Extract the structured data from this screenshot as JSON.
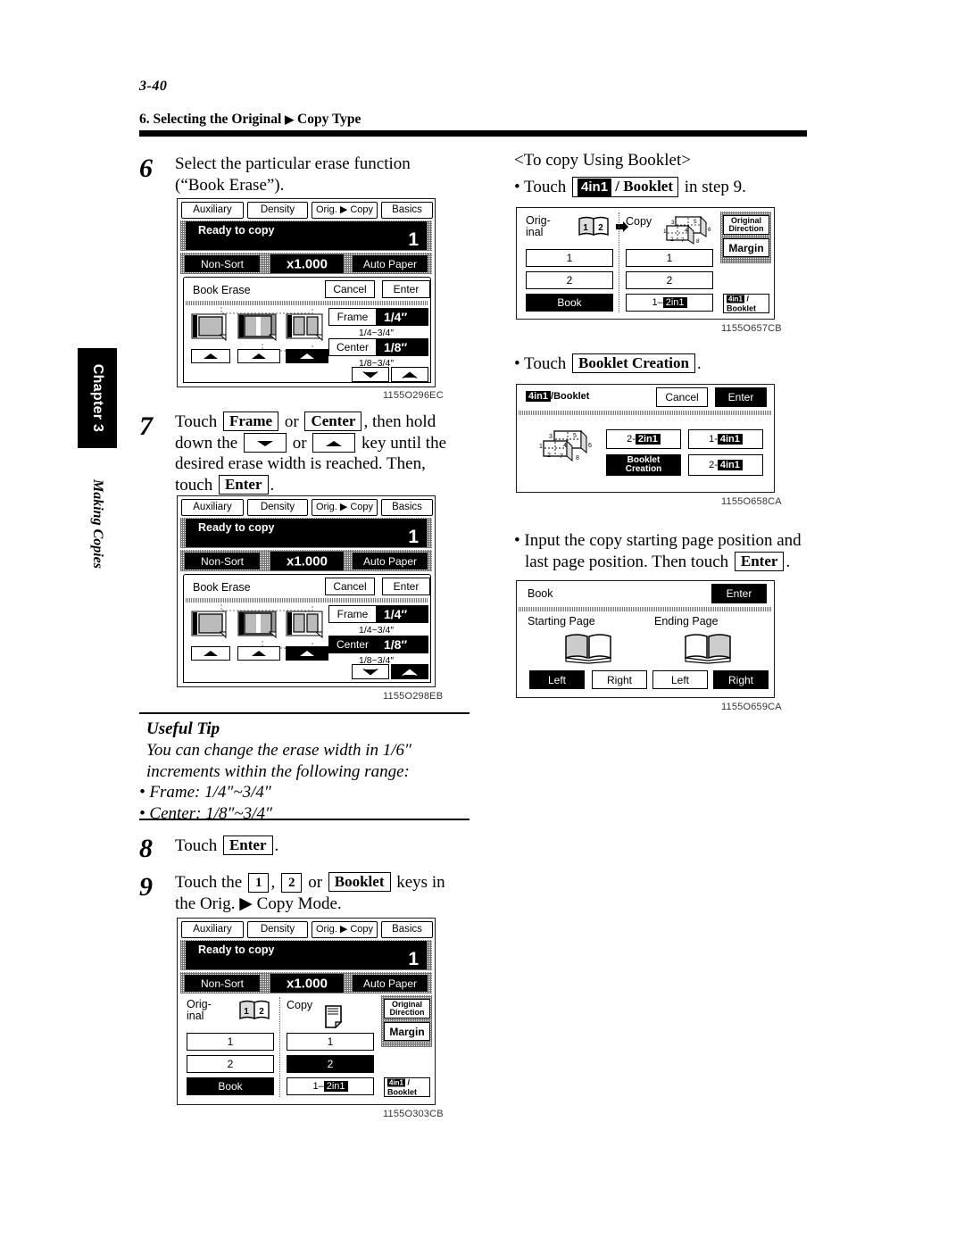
{
  "page": {
    "folio": "3-40",
    "section_title": "6. Selecting the Original",
    "section_title_tail": "Copy Type",
    "chapter_tab": "Chapter 3",
    "chapter_subtitle": "Making Copies"
  },
  "steps": {
    "s6": {
      "num": "6",
      "line1": "Select the particular erase function",
      "line2": "(“Book Erase”)."
    },
    "s7": {
      "num": "7",
      "t1": "Touch",
      "k_frame": "Frame",
      "t2": "or",
      "k_center": "Center",
      "t3": ", then hold",
      "t4": "down the",
      "t5": "or",
      "t6": "key until the",
      "t7": "desired erase width is reached. Then,",
      "t8": "touch",
      "k_enter": "Enter",
      "t9": "."
    },
    "s8": {
      "num": "8",
      "t1": "Touch",
      "k_enter": "Enter",
      "t2": "."
    },
    "s9": {
      "num": "9",
      "t1": "Touch the",
      "k_1": "1",
      "t2": ",",
      "k_2": "2",
      "t3": "or",
      "k_booklet": "Booklet",
      "t4": "keys in",
      "t5": "the Orig.",
      "t6": "Copy Mode."
    }
  },
  "useful_tip": {
    "title": "Useful Tip",
    "line1": "You can change the erase width in 1/6″",
    "line2": "increments within the following range:",
    "bullet1": "• Frame: 1/4″~3/4″",
    "bullet2": "• Center: 1/8″~3/4″"
  },
  "right_column": {
    "heading": "<To copy Using Booklet>",
    "b1": {
      "t1": "• Touch",
      "k_4in1": "4in1",
      "k_booklet": "/ Booklet",
      "t2": "in step 9."
    },
    "b2": {
      "t1": "• Touch",
      "k_bookletcreation": "Booklet Creation",
      "t2": "."
    },
    "b3": {
      "line1": "• Input the copy starting page position and",
      "line2a": "last page position. Then touch",
      "k_enter": "Enter",
      "line2b": "."
    }
  },
  "figure_codes": {
    "f1": "1155O296EC",
    "f2": "1155O298EB",
    "f3": "1155O303CB",
    "f4": "1155O657CB",
    "f5": "1155O658CA",
    "f6": "1155O659CA"
  },
  "lcd_common": {
    "tabs": [
      "Auxiliary",
      "Density",
      "Orig. ▶ Copy",
      "Basics"
    ],
    "status_text": "Ready to copy",
    "copy_count": "1",
    "mode_buttons": [
      "Non-Sort",
      "x1.000",
      "Auto Paper"
    ]
  },
  "book_erase_panel_a": {
    "title": "Book Erase",
    "cancel": "Cancel",
    "enter": "Enter",
    "frame_label": "Frame",
    "frame_value": "1/4″",
    "frame_range": "1/4~3/4″",
    "center_label": "Center",
    "center_value": "1/8″",
    "center_range": "1/8~3/4″",
    "selected_mode_index": 2,
    "frame_selected": false,
    "center_selected": false,
    "up_key_selected": false,
    "down_key_selected": false
  },
  "book_erase_panel_b": {
    "title": "Book Erase",
    "cancel": "Cancel",
    "enter": "Enter",
    "frame_label": "Frame",
    "frame_value": "1/4″",
    "frame_range": "1/4~3/4″",
    "center_label": "Center",
    "center_value": "1/8″",
    "center_range": "1/8~3/4″",
    "selected_mode_index": 2,
    "frame_selected": false,
    "center_selected": true,
    "up_key_selected": true,
    "down_key_selected": false
  },
  "orig_copy_panel_2in1": {
    "original_label_1": "Orig-",
    "original_label_2": "inal",
    "copy_label": "Copy",
    "original_keys": [
      "1",
      "2",
      "Book"
    ],
    "copy_keys": [
      "1",
      "2",
      "1– 2in1"
    ],
    "original_selected": "Book",
    "copy_selected": "2",
    "side_buttons": [
      "Original Direction",
      "Margin",
      "4in1 / Booklet"
    ],
    "original_thumb_digits": [
      "1",
      "2"
    ]
  },
  "orig_copy_panel_4in1": {
    "original_label_1": "Orig-",
    "original_label_2": "inal",
    "copy_label": "Copy",
    "original_keys": [
      "1",
      "2",
      "Book"
    ],
    "copy_keys": [
      "1",
      "2",
      "1– 2in1"
    ],
    "original_selected": "Book",
    "copy_selected": "none",
    "side_buttons": [
      "Original Direction",
      "Margin",
      "4in1 / Booklet"
    ],
    "thumb_digits": [
      "1",
      "2",
      "3",
      "4",
      "5",
      "6",
      "7",
      "8"
    ]
  },
  "booklet_panel": {
    "title_mark": "4in1",
    "title_rest": "/Booklet",
    "cancel": "Cancel",
    "enter": "Enter",
    "keys": [
      {
        "pre": "2-",
        "mark": "2in1",
        "selected": false
      },
      {
        "pre": "1-",
        "mark": "4in1",
        "selected": false
      },
      {
        "pre": "",
        "mark": "Booklet Creation",
        "selected": true
      },
      {
        "pre": "2-",
        "mark": "4in1",
        "selected": false
      }
    ]
  },
  "book_page_panel": {
    "title": "Book",
    "enter": "Enter",
    "starting_label": "Starting Page",
    "ending_label": "Ending Page",
    "starting_keys": [
      {
        "label": "Left",
        "selected": true
      },
      {
        "label": "Right",
        "selected": false
      }
    ],
    "ending_keys": [
      {
        "label": "Left",
        "selected": false
      },
      {
        "label": "Right",
        "selected": true
      }
    ]
  }
}
